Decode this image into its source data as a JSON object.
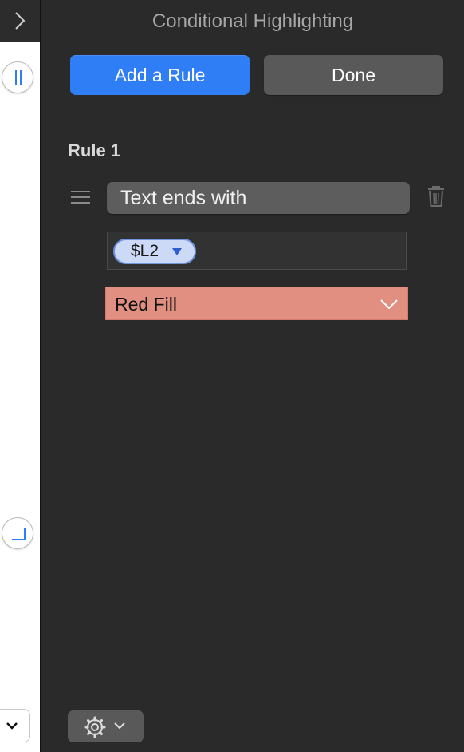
{
  "panel": {
    "title": "Conditional Highlighting",
    "add_rule_label": "Add a Rule",
    "done_label": "Done"
  },
  "rule": {
    "label": "Rule 1",
    "condition": "Text ends with",
    "value_token": "$L2",
    "style": "Red Fill"
  },
  "colors": {
    "accent": "#2f7ef5",
    "style_fill": "#e08f80",
    "panel_bg": "#2a2a2a"
  },
  "icons": [
    "chevron-right-icon",
    "pause-handle-icon",
    "corner-handle-icon",
    "chevron-down-icon",
    "drag-handle-icon",
    "trash-icon",
    "triangle-down-icon",
    "gear-icon"
  ]
}
